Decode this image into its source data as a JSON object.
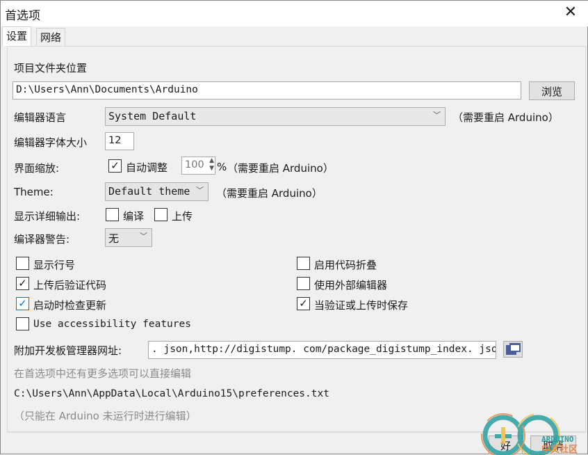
{
  "window": {
    "title": "首选项",
    "close_icon": "close-icon"
  },
  "tabs": [
    {
      "label": "设置",
      "active": true
    },
    {
      "label": "网络",
      "active": false
    }
  ],
  "sketchbook": {
    "label": "项目文件夹位置",
    "value": "D:\\Users\\Ann\\Documents\\Arduino",
    "browse": "浏览"
  },
  "language": {
    "label": "编辑器语言",
    "value": "System Default",
    "note": "（需要重启 Arduino）"
  },
  "font_size": {
    "label": "编辑器字体大小",
    "value": "12"
  },
  "scale": {
    "label": "界面缩放:",
    "auto_label": "自动调整",
    "auto_checked": true,
    "value": "100",
    "unit": "%",
    "note": "（需要重启 Arduino）"
  },
  "theme": {
    "label": "Theme:",
    "value": "Default theme",
    "note": "（需要重启 Arduino）"
  },
  "verbose": {
    "label": "显示详细输出:",
    "compile": "编译",
    "compile_checked": false,
    "upload": "上传",
    "upload_checked": false
  },
  "warnings": {
    "label": "编译器警告:",
    "value": "无"
  },
  "options": [
    {
      "label": "显示行号",
      "checked": false
    },
    {
      "label": "启用代码折叠",
      "checked": false
    },
    {
      "label": "上传后验证代码",
      "checked": true
    },
    {
      "label": "使用外部编辑器",
      "checked": false
    },
    {
      "label": "启动时检查更新",
      "checked": true
    },
    {
      "label": "当验证或上传时保存",
      "checked": true
    },
    {
      "label": "Use accessibility features",
      "checked": false
    }
  ],
  "boards_url": {
    "label": "附加开发板管理器网址:",
    "value": ". json,http://digistump. com/package_digistump_index. json"
  },
  "more_prefs": "在首选项中还有更多选项可以直接编辑",
  "prefs_path": "C:\\Users\\Ann\\AppData\\Local\\Arduino15\\preferences.txt",
  "prefs_note": "（只能在 Arduino 未运行时进行编辑）",
  "buttons": {
    "ok": "好",
    "cancel": "取消"
  },
  "watermark": {
    "text1": "ARDUINO",
    "text2": "中文社区"
  },
  "colors": {
    "accent": "#0078d7",
    "logo_teal": "#2a9fa0",
    "logo_orange": "#e8884a",
    "logo_yellow": "#eec04a"
  }
}
